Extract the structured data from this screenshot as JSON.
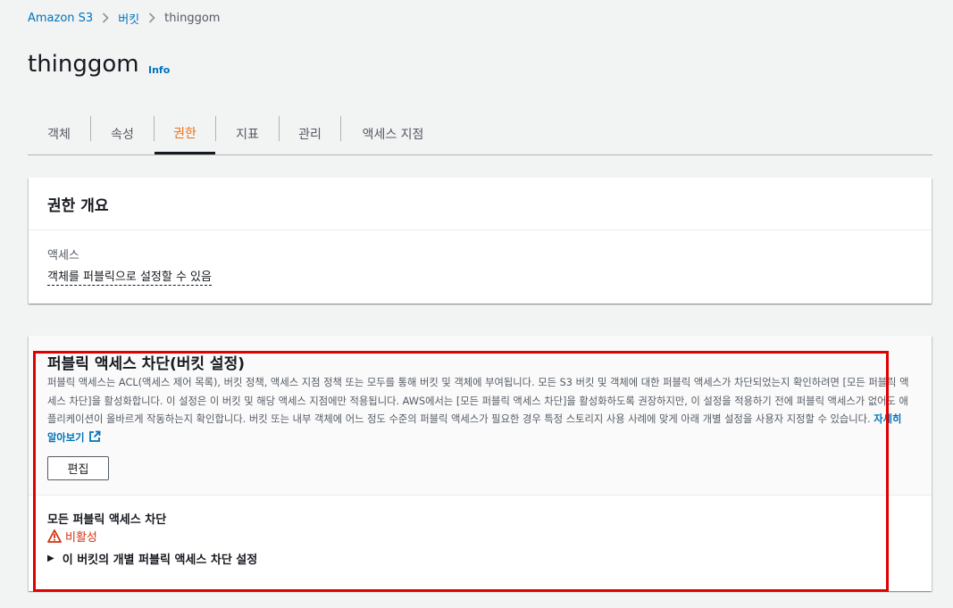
{
  "breadcrumb": {
    "items": [
      "Amazon S3",
      "버킷"
    ],
    "current": "thinggom"
  },
  "page": {
    "title": "thinggom",
    "info_label": "Info"
  },
  "tabs": [
    {
      "label": "객체"
    },
    {
      "label": "속성"
    },
    {
      "label": "권한",
      "active": true
    },
    {
      "label": "지표"
    },
    {
      "label": "관리"
    },
    {
      "label": "액세스 지점"
    }
  ],
  "permissions_overview": {
    "title": "권한 개요",
    "access_label": "액세스",
    "access_value": "객체를 퍼블릭으로 설정할 수 있음"
  },
  "block_public_access": {
    "title": "퍼블릭 액세스 차단(버킷 설정)",
    "description": "퍼블릭 액세스는 ACL(액세스 제어 목록), 버킷 정책, 액세스 지점 정책 또는 모두를 통해 버킷 및 객체에 부여됩니다. 모든 S3 버킷 및 객체에 대한 퍼블릭 액세스가 차단되었는지 확인하려면 [모든 퍼블릭 액세스 차단]을 활성화합니다. 이 설정은 이 버킷 및 해당 액세스 지점에만 적용됩니다. AWS에서는 [모든 퍼블릭 액세스 차단]을 활성화하도록 권장하지만, 이 설정을 적용하기 전에 퍼블릭 액세스가 없어도 애플리케이션이 올바르게 작동하는지 확인합니다. 버킷 또는 내부 객체에 어느 정도 수준의 퍼블릭 액세스가 필요한 경우 특정 스토리지 사용 사례에 맞게 아래 개별 설정을 사용자 지정할 수 있습니다.",
    "learn_more": "자세히 알아보기",
    "edit_button": "편집",
    "block_all_label": "모든 퍼블릭 액세스 차단",
    "status": "비활성",
    "expander_label": "이 버킷의 개별 퍼블릭 액세스 차단 설정"
  },
  "colors": {
    "link": "#0073bb",
    "active_tab": "#ec7211",
    "warning": "#d13212",
    "highlight": "#e00000"
  },
  "icons": [
    "chevron-right-icon",
    "external-link-icon",
    "warning-icon",
    "caret-right-icon"
  ]
}
